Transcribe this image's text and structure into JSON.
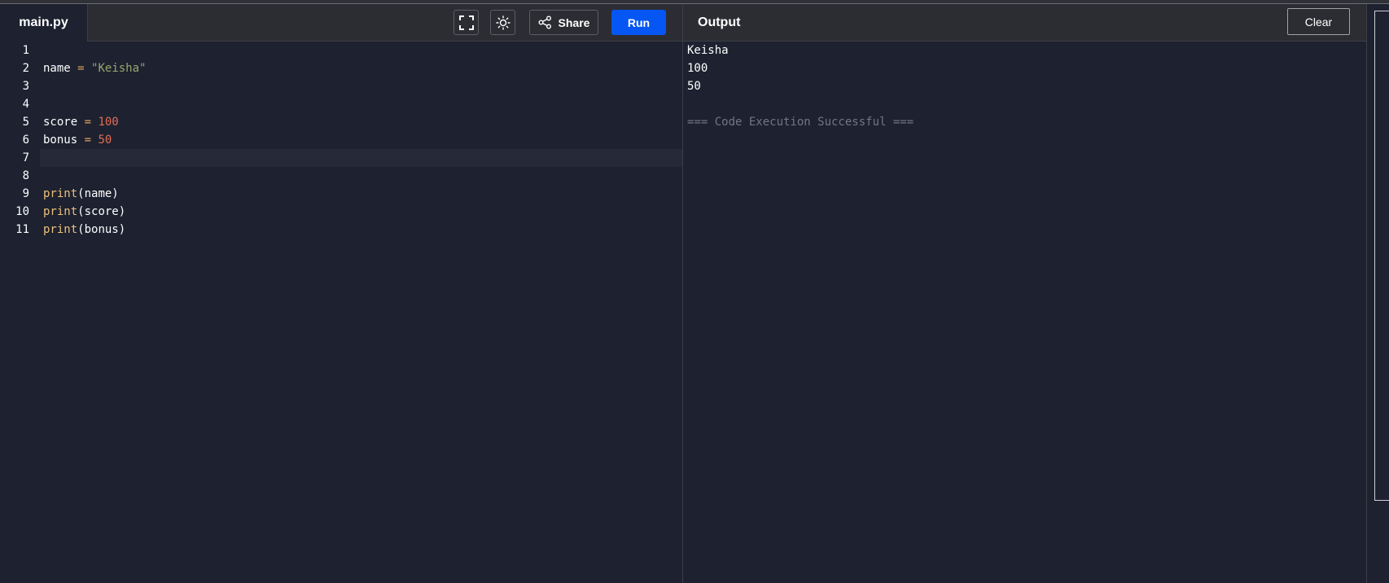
{
  "editor": {
    "tab_label": "main.py",
    "toolbar": {
      "fullscreen_icon": "fullscreen-icon",
      "theme_icon": "sun-icon",
      "share_label": "Share",
      "share_icon": "share-icon",
      "run_label": "Run"
    },
    "lines": [
      {
        "num": "1",
        "tokens": []
      },
      {
        "num": "2",
        "tokens": [
          {
            "t": "name ",
            "c": ""
          },
          {
            "t": "=",
            "c": "op"
          },
          {
            "t": " ",
            "c": ""
          },
          {
            "t": "\"Keisha\"",
            "c": "str"
          }
        ]
      },
      {
        "num": "3",
        "tokens": []
      },
      {
        "num": "4",
        "tokens": []
      },
      {
        "num": "5",
        "tokens": [
          {
            "t": "score ",
            "c": ""
          },
          {
            "t": "=",
            "c": "op"
          },
          {
            "t": " ",
            "c": ""
          },
          {
            "t": "100",
            "c": "num"
          }
        ]
      },
      {
        "num": "6",
        "tokens": [
          {
            "t": "bonus ",
            "c": ""
          },
          {
            "t": "=",
            "c": "op"
          },
          {
            "t": " ",
            "c": ""
          },
          {
            "t": "50",
            "c": "num"
          }
        ]
      },
      {
        "num": "7",
        "tokens": [],
        "active": true
      },
      {
        "num": "8",
        "tokens": []
      },
      {
        "num": "9",
        "tokens": [
          {
            "t": "print",
            "c": "fn"
          },
          {
            "t": "(name)",
            "c": ""
          }
        ]
      },
      {
        "num": "10",
        "tokens": [
          {
            "t": "print",
            "c": "fn"
          },
          {
            "t": "(score)",
            "c": ""
          }
        ]
      },
      {
        "num": "11",
        "tokens": [
          {
            "t": "print",
            "c": "fn"
          },
          {
            "t": "(bonus)",
            "c": ""
          }
        ]
      }
    ]
  },
  "output": {
    "title": "Output",
    "clear_label": "Clear",
    "lines": [
      "Keisha",
      "100",
      "50",
      ""
    ],
    "status": "=== Code Execution Successful ==="
  },
  "colors": {
    "run_button": "#0556f3",
    "background": "#1d2130",
    "header": "#2c2d33"
  }
}
